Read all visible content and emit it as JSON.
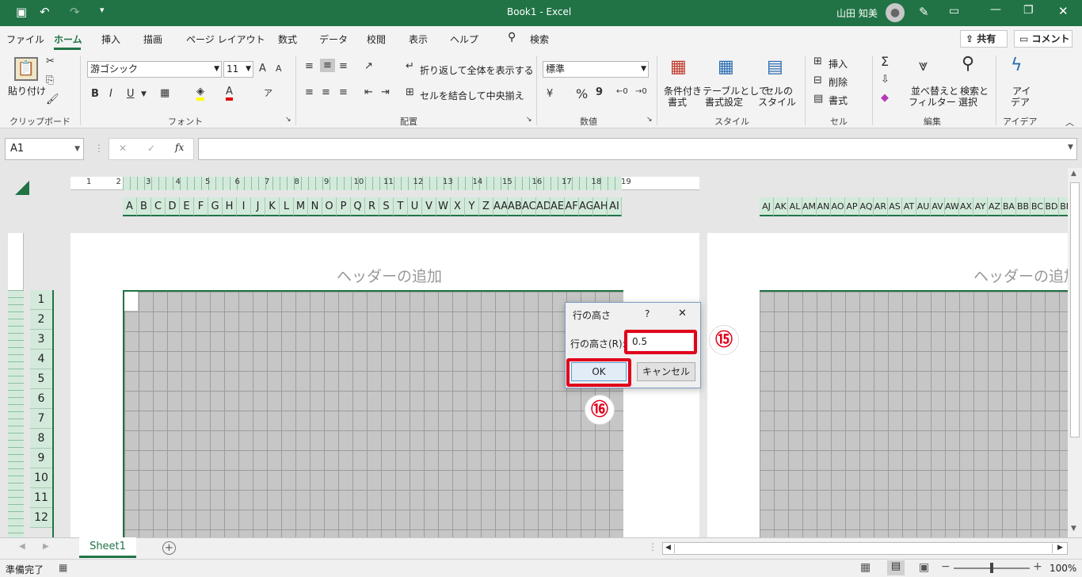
{
  "app": {
    "title": "Book1 - Excel",
    "user_name": "山田 知美",
    "share_label": "共有",
    "comment_label": "コメント"
  },
  "menu": {
    "tabs": [
      "ファイル",
      "ホーム",
      "挿入",
      "描画",
      "ページ レイアウト",
      "数式",
      "データ",
      "校閲",
      "表示",
      "ヘルプ"
    ],
    "active_tab": "ホーム",
    "search_label": "検索"
  },
  "ribbon": {
    "clipboard": {
      "paste_label": "貼り付け",
      "group_label": "クリップボード"
    },
    "font": {
      "font_name": "游ゴシック",
      "font_size": "11",
      "bold": "B",
      "italic": "I",
      "underline": "U",
      "grow": "A",
      "shrink": "A",
      "group_label": "フォント"
    },
    "alignment": {
      "wrap_label": "折り返して全体を表示する",
      "merge_label": "セルを結合して中央揃え",
      "group_label": "配置"
    },
    "number": {
      "format": "標準",
      "percent": "%",
      "comma": "9",
      "group_label": "数値"
    },
    "styles": {
      "cond_format": [
        "条件付き",
        "書式"
      ],
      "table_format": [
        "テーブルとして",
        "書式設定"
      ],
      "cell_styles": [
        "セルの",
        "スタイル"
      ],
      "group_label": "スタイル"
    },
    "cells": {
      "insert_label": "挿入",
      "delete_label": "削除",
      "format_label": "書式",
      "group_label": "セル"
    },
    "editing": {
      "sum_symbol": "Σ",
      "sort_filter": [
        "並べ替えと",
        "フィルター"
      ],
      "find_select": [
        "検索と",
        "選択"
      ],
      "group_label": "編集"
    },
    "ideas": {
      "label": [
        "アイ",
        "デア"
      ],
      "group_label": "アイデア"
    }
  },
  "formula_bar": {
    "name_box": "A1",
    "fx": "fx",
    "cancel": "✕",
    "enter": "✓",
    "value": ""
  },
  "ruler": {
    "numbers": [
      "1",
      "2",
      "3",
      "4",
      "5",
      "6",
      "7",
      "8",
      "9",
      "10",
      "11",
      "12",
      "13",
      "14",
      "15",
      "16",
      "17",
      "18",
      "19"
    ]
  },
  "columns_left": [
    "A",
    "B",
    "C",
    "D",
    "E",
    "F",
    "G",
    "H",
    "I",
    "J",
    "K",
    "L",
    "M",
    "N",
    "O",
    "P",
    "Q",
    "R",
    "S",
    "T",
    "U",
    "V",
    "W",
    "X",
    "Y",
    "Z",
    "AA",
    "AB",
    "AC",
    "AD",
    "AE",
    "AF",
    "AG",
    "AH",
    "AI"
  ],
  "columns_right": [
    "AJ",
    "AK",
    "AL",
    "AM",
    "AN",
    "AO",
    "AP",
    "AQ",
    "AR",
    "AS",
    "AT",
    "AU",
    "AV",
    "AW",
    "AX",
    "AY",
    "AZ",
    "BA",
    "BB",
    "BC",
    "BD",
    "BE"
  ],
  "rows": [
    "1",
    "2",
    "3",
    "4",
    "5",
    "6",
    "7",
    "8",
    "9",
    "10",
    "11",
    "12"
  ],
  "page": {
    "header_placeholder_left": "ヘッダーの追加",
    "header_placeholder_right": "ヘッダーの追加"
  },
  "dialog": {
    "title": "行の高さ",
    "help": "?",
    "close": "✕",
    "field_label": "行の高さ(R):",
    "field_value": "0.5",
    "ok_label": "OK",
    "cancel_label": "キャンセル"
  },
  "annotations": {
    "step15": "⑮",
    "step16": "⑯",
    "highlight_color": "#e0001b"
  },
  "sheet_tabs": {
    "active": "Sheet1",
    "add": "+"
  },
  "status": {
    "ready": "準備完了",
    "zoom": "100%"
  },
  "colors": {
    "excel_green": "#217346",
    "selected_header": "#d3eadb",
    "grid_fill": "#c6c6c6"
  }
}
